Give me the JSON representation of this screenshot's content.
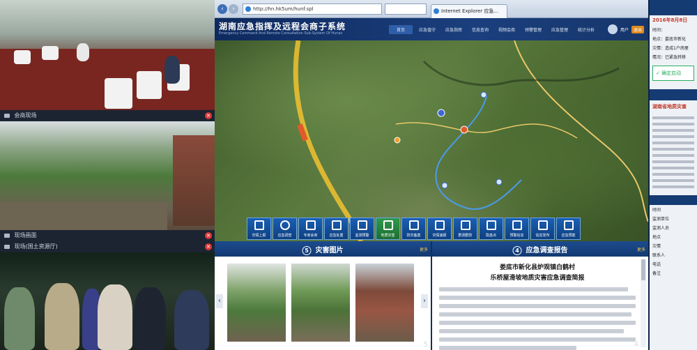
{
  "feeds": [
    {
      "label": "会商现场"
    },
    {
      "label": "现场画面"
    },
    {
      "label": "现场(国土资源厅)"
    }
  ],
  "browser": {
    "url": "http://hn.hk5um/hunf.spl",
    "tab_title": "Internet Explorer 应急..."
  },
  "app": {
    "title": "湖南应急指挥及远程会商子系统",
    "subtitle": "Emergency Command And Remote Consultation Sub-System Of Hunan",
    "menu": [
      "首页",
      "应急值守",
      "应急指挥",
      "信息查询",
      "视频会商",
      "预警管理",
      "应急管理",
      "统计分析"
    ],
    "active_menu": 0,
    "user": {
      "name": "用户",
      "logout": "退出"
    }
  },
  "toolbar": [
    "灾情上报",
    "应急调查",
    "专家会商",
    "应急处置",
    "监测预警",
    "地质灾害",
    "防灾备案",
    "灾情速报",
    "群测群防",
    "隐患点",
    "预警信息",
    "信息发布",
    "应急预案",
    "装备管理",
    "专家管理"
  ],
  "panel_photos": {
    "number": "5",
    "title": "灾害图片",
    "more": "更多",
    "count": "5",
    "prev": "‹",
    "next": "›"
  },
  "panel_report": {
    "number": "4",
    "title": "应急调查报告",
    "more": "更多",
    "heading1": "娄底市新化县炉观镇白鹤村",
    "heading2": "乐桥屋滑坡地质灾害应急调查简报",
    "count": "4"
  },
  "side": {
    "date": "2016年8月8日",
    "rows": [
      "时间：",
      "地点：娄底市新化",
      "灾情：造成1户房屋",
      "",
      "情况：已紧急转移"
    ],
    "ok": "确定启动",
    "title": "湖南省地质灾害",
    "rows2": [
      "时间",
      "监测单位",
      "监测人员",
      "地点",
      "灾情",
      "联系人",
      "电话",
      "备注"
    ]
  }
}
